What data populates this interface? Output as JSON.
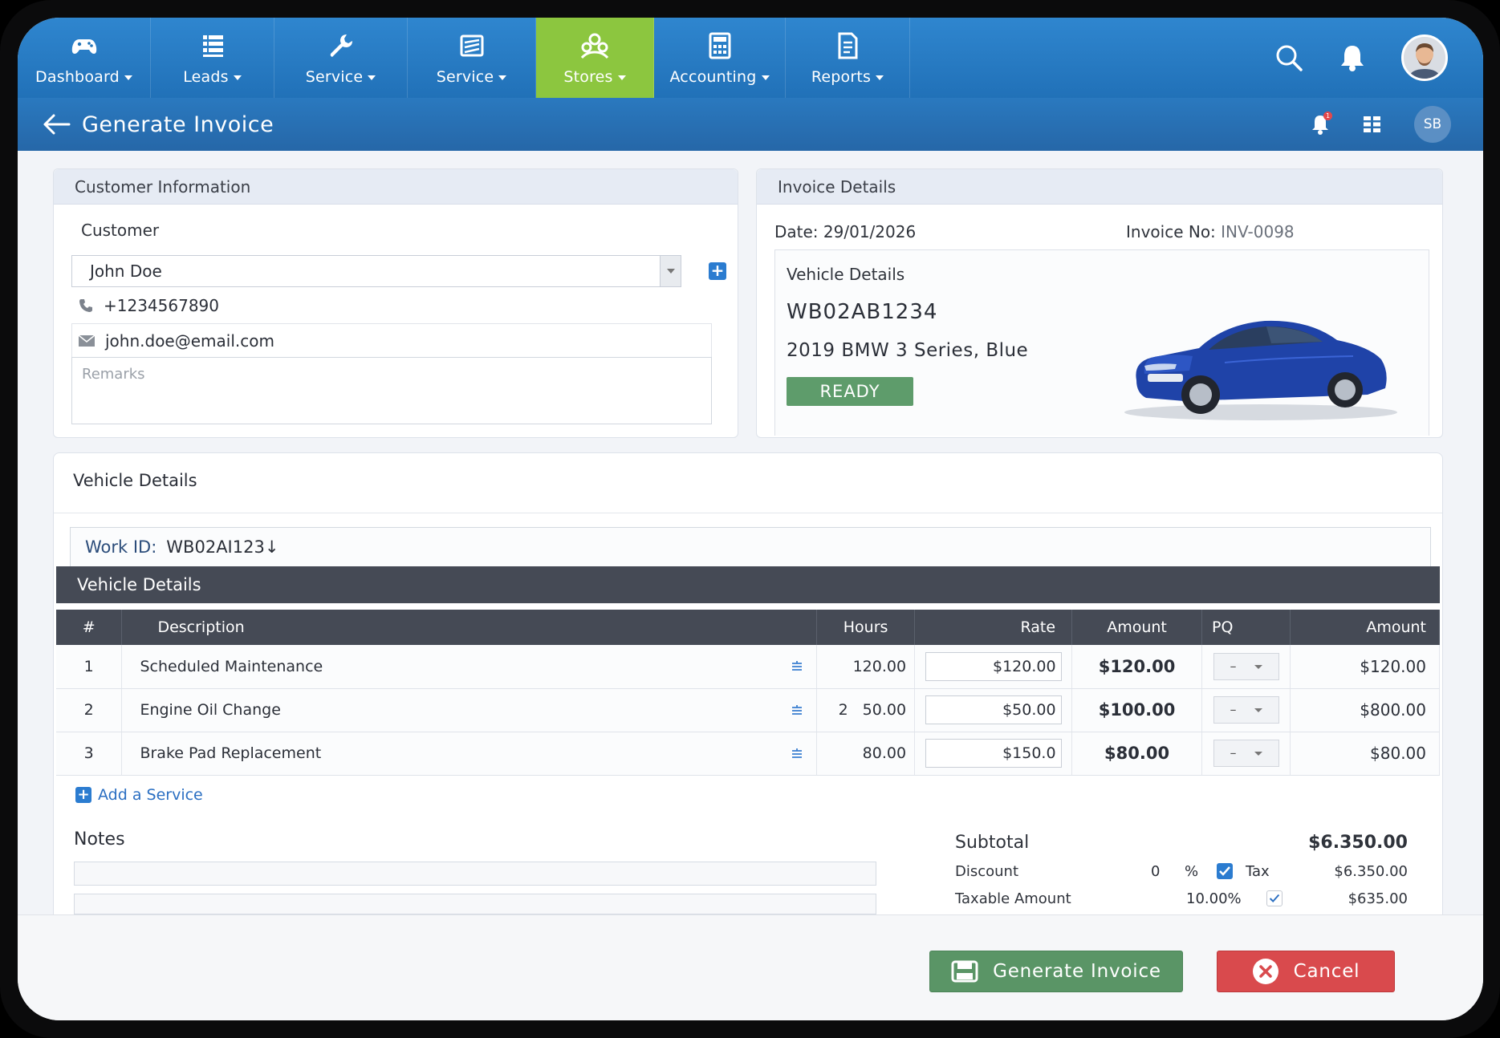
{
  "nav": {
    "items": [
      {
        "label": "Dashboard",
        "icon": "gamepad-icon"
      },
      {
        "label": "Leads",
        "icon": "list-icon"
      },
      {
        "label": "Service",
        "icon": "wrench-icon"
      },
      {
        "label": "Service",
        "icon": "layers-icon"
      },
      {
        "label": "Stores",
        "icon": "people-icon",
        "active": true
      },
      {
        "label": "Accounting",
        "icon": "calculator-icon"
      },
      {
        "label": "Reports",
        "icon": "document-icon"
      }
    ],
    "active_color": "#8cc63f"
  },
  "titlebar": {
    "title": "Generate Invoice",
    "user_initials": "SB",
    "notification_count": "1"
  },
  "customer": {
    "section_title": "Customer Information",
    "label": "Customer",
    "name": "John Doe",
    "phone": "+1234567890",
    "email": "john.doe@email.com",
    "remarks_placeholder": "Remarks"
  },
  "invoice": {
    "section_title": "Invoice Details",
    "date_label": "Date:",
    "date": "29/01/2026",
    "number_label": "Invoice No:",
    "number": "INV-0098",
    "vehicle_title": "Vehicle Details",
    "plate": "WB02AB1234",
    "model": "2019 BMW 3 Series, Blue",
    "status": "READY",
    "status_color": "#5e9c6b"
  },
  "vehicle_section": {
    "title": "Vehicle Details",
    "work_id_label": "Work ID:",
    "work_id": "WB02AI123↓"
  },
  "services": {
    "title": "Vehicle Details",
    "columns": [
      "#",
      "Description",
      "Hours",
      "Rate",
      "Amount",
      "PQ",
      "Amount"
    ],
    "rows": [
      {
        "num": "1",
        "desc": "Scheduled Maintenance",
        "hours": "120.00",
        "rate": "$120.00",
        "amount": "$120.00",
        "pq": "–",
        "total": "$120.00"
      },
      {
        "num": "2",
        "desc": "Engine Oil Change",
        "hours_prefix": "2",
        "hours": "50.00",
        "rate": "$50.00",
        "amount": "$100.00",
        "pq": "–",
        "total": "$800.00"
      },
      {
        "num": "3",
        "desc": "Brake Pad Replacement",
        "hours": "80.00",
        "rate": "$150.0",
        "amount": "$80.00",
        "pq": "–",
        "total": "$80.00"
      }
    ],
    "add_label": "Add a Service"
  },
  "notes": {
    "label": "Notes"
  },
  "totals": {
    "subtotal_label": "Subtotal",
    "subtotal": "$6.350.00",
    "discount_label": "Discount",
    "discount_value": "0",
    "percent_sign": "%",
    "tax_label": "Tax",
    "tax_total": "$6.350.00",
    "taxable_label": "Taxable Amount",
    "taxable_rate": "10.00%",
    "taxable_value": "$635.00"
  },
  "actions": {
    "generate_label": "Generate Invoice",
    "cancel_label": "Cancel",
    "generate_color": "#5a9566",
    "cancel_color": "#d94a4d"
  }
}
